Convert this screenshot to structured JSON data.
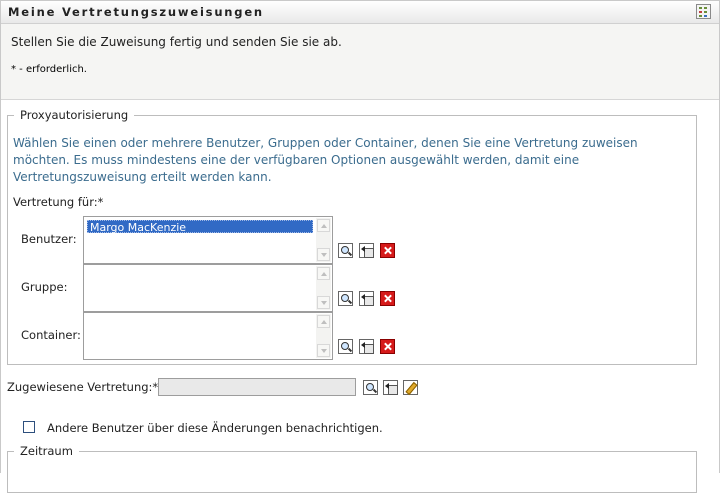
{
  "header": {
    "title": "Meine Vertretungszuweisungen",
    "menu_icon": "grid-menu-icon"
  },
  "intro": {
    "text": "Stellen Sie die Zuweisung fertig und senden Sie sie ab.",
    "required_note": "* - erforderlich."
  },
  "proxy_section": {
    "legend": "Proxyautorisierung",
    "description": "Wählen Sie einen oder mehrere Benutzer, Gruppen oder Container, denen Sie eine Vertretung zuweisen möchten. Es muss mindestens eine der verfügbaren Optionen ausgewählt werden, damit eine Vertretungszuweisung erteilt werden kann.",
    "vertretung_label": "Vertretung für:*",
    "rows": [
      {
        "label": "Benutzer:",
        "selected_item": "Margo MacKenzie"
      },
      {
        "label": "Gruppe:",
        "selected_item": ""
      },
      {
        "label": "Container:",
        "selected_item": ""
      }
    ]
  },
  "assigned": {
    "label": "Zugewiesene Vertretung:*",
    "value": ""
  },
  "notify": {
    "label": "Andere Benutzer über diese Änderungen benachrichtigen.",
    "checked": false
  },
  "zeitraum": {
    "legend": "Zeitraum"
  },
  "colors": {
    "accent_text": "#3b6c8e",
    "selection": "#316ac5",
    "clear_button": "#d61a1a"
  }
}
